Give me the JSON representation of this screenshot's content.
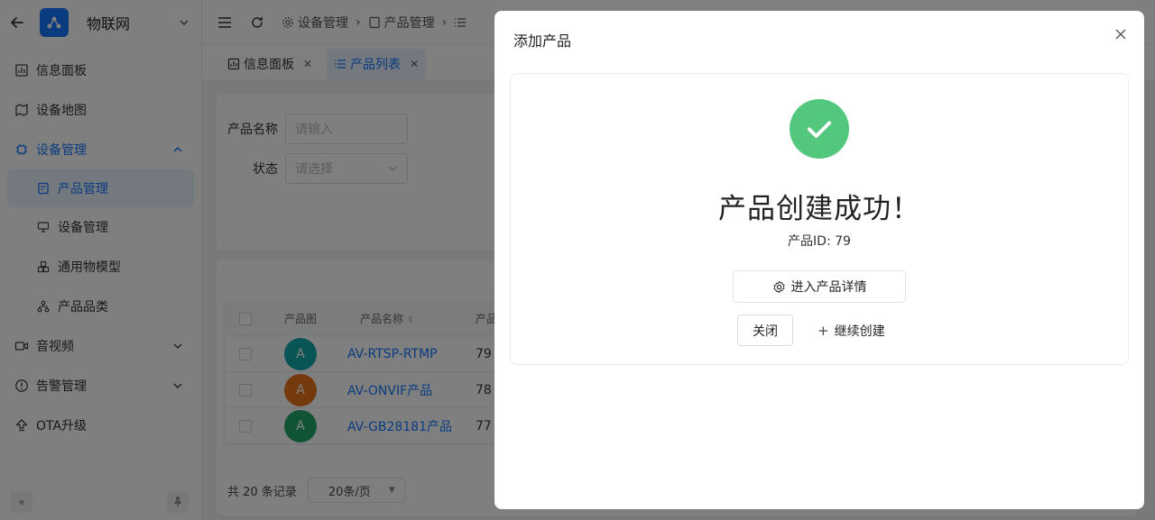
{
  "app": {
    "title": "物联网",
    "brand_color": "#1677ff"
  },
  "sidebar": {
    "items": [
      {
        "label": "信息面板"
      },
      {
        "label": "设备地图"
      },
      {
        "label": "设备管理"
      },
      {
        "label": "产品管理"
      },
      {
        "label": "设备管理"
      },
      {
        "label": "通用物模型"
      },
      {
        "label": "产品品类"
      },
      {
        "label": "音视频"
      },
      {
        "label": "告警管理"
      },
      {
        "label": "OTA升级"
      }
    ]
  },
  "breadcrumb": {
    "items": [
      "设备管理",
      "产品管理"
    ]
  },
  "tabs": [
    {
      "label": "信息面板"
    },
    {
      "label": "产品列表"
    }
  ],
  "search": {
    "name_label": "产品名称",
    "name_placeholder": "请输入",
    "status_label": "状态",
    "status_placeholder": "请选择"
  },
  "table": {
    "headers": [
      "产品图",
      "产品名称",
      "产品"
    ],
    "rows": [
      {
        "avatar": "A",
        "avatar_color": "#13a8a8",
        "name": "AV-RTSP-RTMP",
        "id": "79"
      },
      {
        "avatar": "A",
        "avatar_color": "#e8731a",
        "name": "AV-ONVIF产品",
        "id": "78"
      },
      {
        "avatar": "A",
        "avatar_color": "#22a96b",
        "name": "AV-GB28181产品",
        "id": "77"
      }
    ]
  },
  "pager": {
    "total": "共 20 条记录",
    "page_size": "20条/页"
  },
  "modal": {
    "title": "添加产品",
    "success_title": "产品创建成功！",
    "product_id": "产品ID: 79",
    "detail_button": "进入产品详情",
    "close_button": "关闭",
    "continue_button": "继续创建",
    "success_color": "#52c77d"
  }
}
